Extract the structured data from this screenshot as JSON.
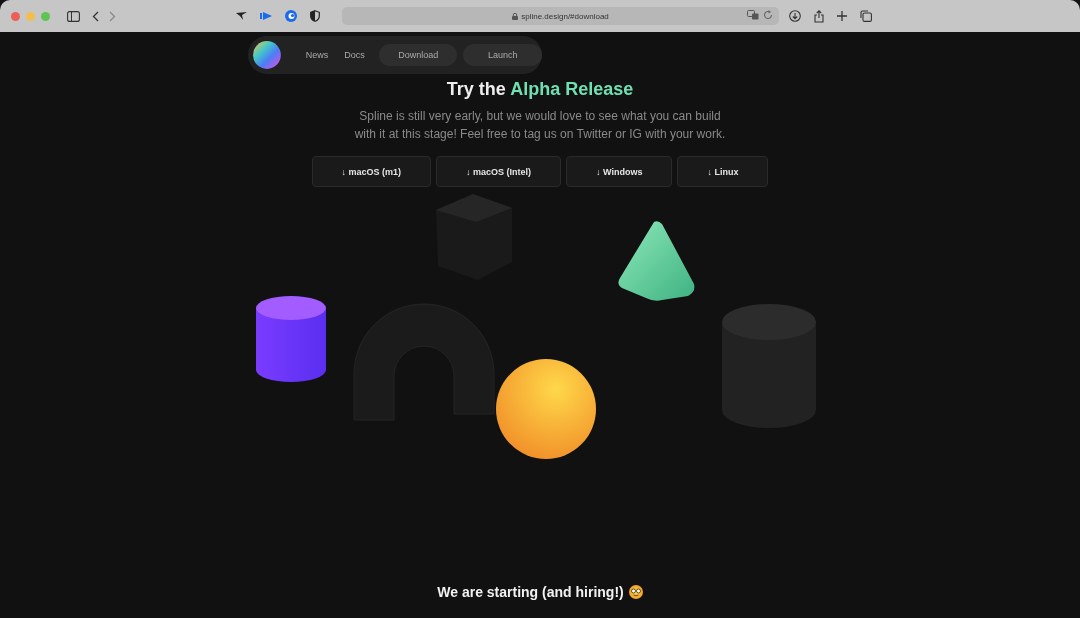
{
  "browser": {
    "url": "spline.design/#download"
  },
  "nav": {
    "items": [
      {
        "label": "News",
        "kind": "link"
      },
      {
        "label": "Docs",
        "kind": "link"
      },
      {
        "label": "Download",
        "kind": "pill"
      },
      {
        "label": "Launch",
        "kind": "pill"
      }
    ]
  },
  "hero": {
    "title": "Try the",
    "title_highlight": "Alpha Release",
    "lines": [
      "Spline is still very early, but we would love to see what you can build",
      "with it at this stage! Feel free to tag us on Twitter or IG with your work."
    ]
  },
  "downloads": [
    "↓ macOS (m1)",
    "↓ macOS (Intel)",
    "↓ Windows",
    "↓ Linux"
  ],
  "hiring": {
    "title": "We are starting (and hiring!)"
  }
}
